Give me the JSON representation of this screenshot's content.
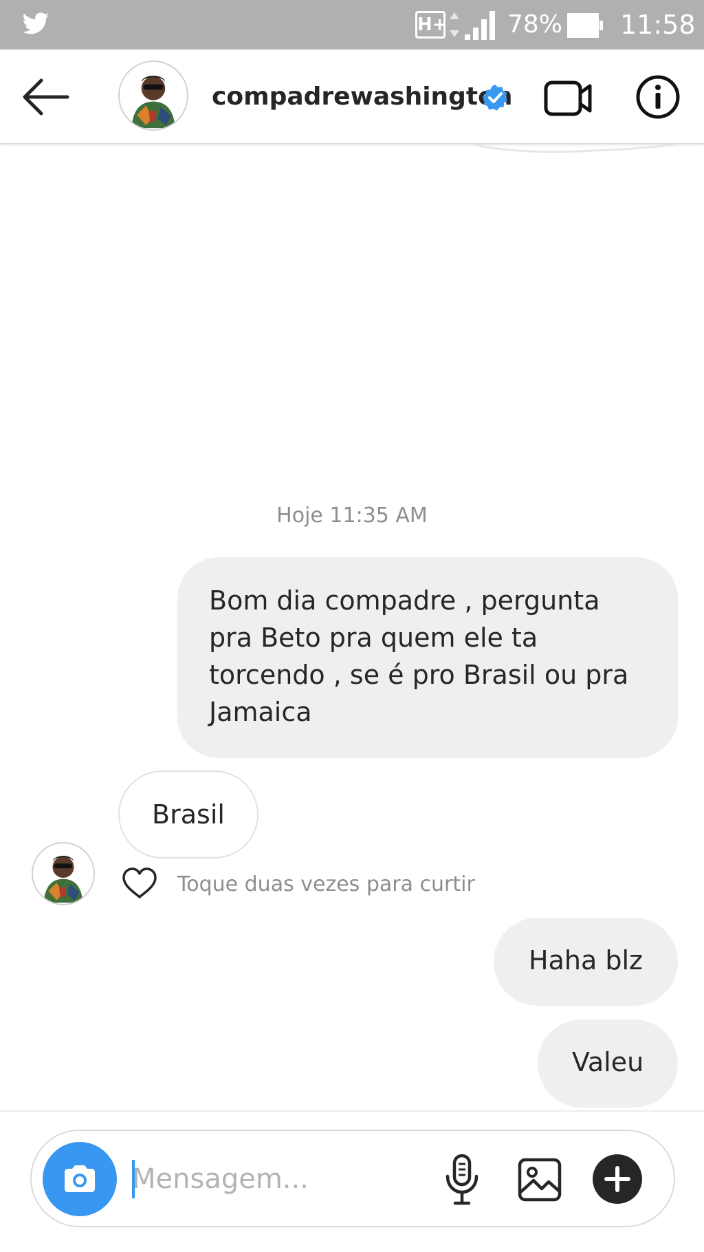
{
  "status_bar": {
    "app_icon": "twitter-icon",
    "network": "H+",
    "battery_percent": "78%",
    "time": "11:58"
  },
  "header": {
    "back_icon": "arrow-left-icon",
    "username": "compadrewashington",
    "verified_icon": "verified-badge-icon",
    "video_icon": "video-camera-icon",
    "info_icon": "info-icon"
  },
  "conversation": {
    "timestamp": "Hoje 11:35 AM",
    "messages": [
      {
        "direction": "outgoing",
        "text": "Bom dia compadre , pergunta pra Beto pra quem ele ta torcendo , se é pro Brasil ou pra Jamaica"
      },
      {
        "direction": "incoming",
        "text": "Brasil"
      },
      {
        "direction": "outgoing",
        "text": "Haha blz"
      },
      {
        "direction": "outgoing",
        "text": "Valeu"
      }
    ],
    "like_hint": "Toque duas vezes para curtir",
    "like_icon": "heart-outline-icon"
  },
  "composer": {
    "placeholder": "Mensagem...",
    "value": "",
    "camera_icon": "camera-icon",
    "mic_icon": "microphone-icon",
    "gallery_icon": "image-gallery-icon",
    "plus_icon": "plus-circle-icon"
  },
  "colors": {
    "accent": "#3897f0",
    "status_bar": "#b0b0b0",
    "outgoing_bubble": "#efefef",
    "secondary_text": "#8e8e8e"
  }
}
